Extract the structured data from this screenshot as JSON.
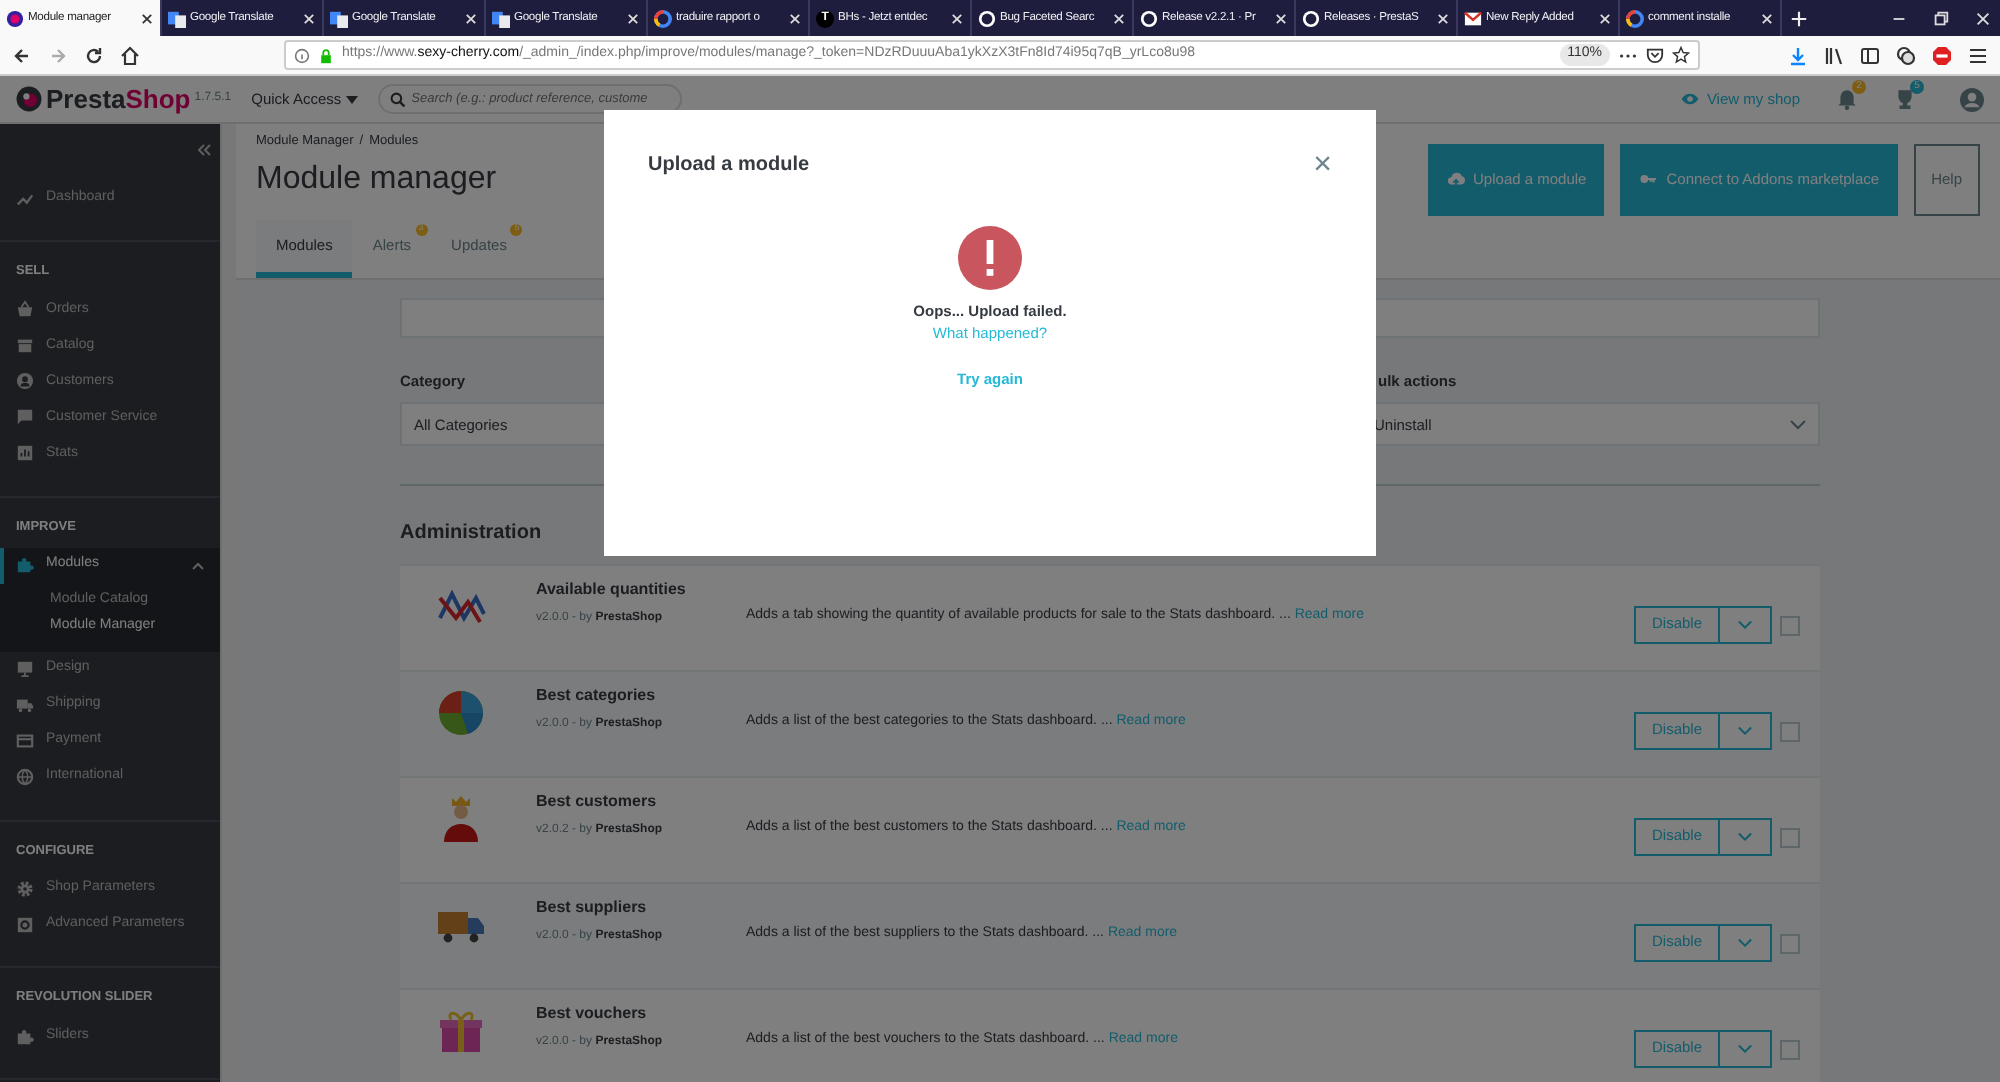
{
  "browser": {
    "tabs": [
      {
        "title": "Module manager",
        "selected": true
      },
      {
        "title": "Google Translate",
        "selected": false
      },
      {
        "title": "Google Translate",
        "selected": false
      },
      {
        "title": "Google Translate",
        "selected": false
      },
      {
        "title": "traduire rapport o",
        "selected": false
      },
      {
        "title": "BHs - Jetzt entdec",
        "letter": "T",
        "selected": false
      },
      {
        "title": "Bug Faceted Searc",
        "selected": false
      },
      {
        "title": "Release v2.2.1 · Pr",
        "selected": false
      },
      {
        "title": "Releases · PrestaS",
        "selected": false
      },
      {
        "title": "New Reply Added",
        "selected": false
      },
      {
        "title": "comment installe",
        "selected": false
      }
    ],
    "url": "https://www.**sexy-cherry.com**/_admin_/index.php/improve/modules/manage?_token=NDzRDuuuAba1ykXzX3tFn8Id74i95q7qB_yrLco8u98",
    "zoom": "110%"
  },
  "header": {
    "logo": [
      "Presta",
      "Shop"
    ],
    "version": "1.7.5.1",
    "quick_access": "Quick Access",
    "search_placeholder": "Search (e.g.: product reference, custome",
    "view_shop": "View my shop",
    "notifications": [
      {
        "count": "2"
      },
      {
        "count": "5"
      }
    ]
  },
  "sidebar": {
    "groups": [
      {
        "items": [
          {
            "label": "Dashboard",
            "selected": false,
            "expanded": false
          }
        ]
      },
      {
        "title": "SELL",
        "items": [
          {
            "label": "Orders",
            "selected": false,
            "expanded": false
          },
          {
            "label": "Catalog",
            "selected": false,
            "expanded": false
          },
          {
            "label": "Customers",
            "selected": false,
            "expanded": false
          },
          {
            "label": "Customer Service",
            "selected": false,
            "expanded": false
          },
          {
            "label": "Stats",
            "selected": false,
            "expanded": false
          }
        ]
      },
      {
        "title": "IMPROVE",
        "items": [
          {
            "label": "Modules",
            "selected": true,
            "expanded": true,
            "children": [
              {
                "label": "Module Catalog",
                "selected": false
              },
              {
                "label": "Module Manager",
                "selected": true
              }
            ]
          },
          {
            "label": "Design",
            "selected": false,
            "expanded": false
          },
          {
            "label": "Shipping",
            "selected": false,
            "expanded": false
          },
          {
            "label": "Payment",
            "selected": false,
            "expanded": false
          },
          {
            "label": "International",
            "selected": false,
            "expanded": false
          }
        ]
      },
      {
        "title": "CONFIGURE",
        "items": [
          {
            "label": "Shop Parameters",
            "selected": false,
            "expanded": false
          },
          {
            "label": "Advanced Parameters",
            "selected": false,
            "expanded": false
          }
        ]
      },
      {
        "title": "REVOLUTION SLIDER",
        "items": [
          {
            "label": "Sliders",
            "selected": false,
            "expanded": false
          }
        ]
      }
    ]
  },
  "page": {
    "breadcrumb": [
      "Module Manager",
      "Modules"
    ],
    "breadcrumb_separator": "/",
    "title": "Module manager",
    "toolbar": [
      {
        "label": "Upload a module",
        "kind": "primary"
      },
      {
        "label": "Connect to Addons marketplace",
        "kind": "primary"
      },
      {
        "label": "Help",
        "kind": "outline"
      }
    ],
    "tabs": [
      {
        "label": "Modules",
        "selected": true
      },
      {
        "label": "Alerts",
        "badge": "3",
        "selected": false
      },
      {
        "label": "Updates",
        "badge": "5",
        "selected": false
      }
    ],
    "filters": {
      "category_label": "Category",
      "category_value": "All Categories",
      "bulk_label": "ulk actions",
      "bulk_value": "Uninstall"
    },
    "section_title": "Administration",
    "modules": [
      {
        "name": "Available quantities",
        "byline": "v2.0.0 - by **PrestaShop**",
        "description": "Adds a tab showing the quantity of available products for sale to the Stats dashboard. ...",
        "read_more": "Read more",
        "action": "Disable",
        "checked": false
      },
      {
        "name": "Best categories",
        "byline": "v2.0.0 - by **PrestaShop**",
        "description": "Adds a list of the best categories to the Stats dashboard. ...",
        "read_more": "Read more",
        "action": "Disable",
        "checked": false
      },
      {
        "name": "Best customers",
        "byline": "v2.0.2 - by **PrestaShop**",
        "description": "Adds a list of the best customers to the Stats dashboard. ...",
        "read_more": "Read more",
        "action": "Disable",
        "checked": false
      },
      {
        "name": "Best suppliers",
        "byline": "v2.0.0 - by **PrestaShop**",
        "description": "Adds a list of the best suppliers to the Stats dashboard. ...",
        "read_more": "Read more",
        "action": "Disable",
        "checked": false
      },
      {
        "name": "Best vouchers",
        "byline": "v2.0.0 - by **PrestaShop**",
        "description": "Adds a list of the best vouchers to the Stats dashboard. ...",
        "read_more": "Read more",
        "action": "Disable",
        "checked": false
      }
    ]
  },
  "modal": {
    "title": "Upload a module",
    "close": "×",
    "message": "Oops... Upload failed.",
    "help_link": "What happened?",
    "retry_link": "Try again"
  }
}
